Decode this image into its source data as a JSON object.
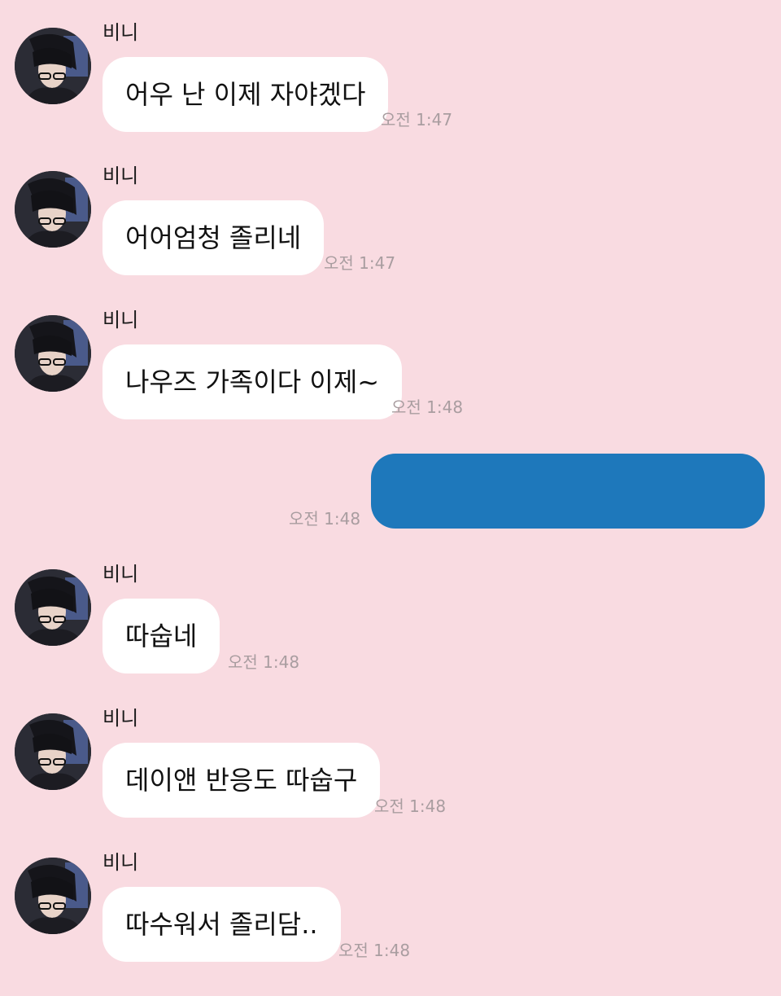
{
  "messages": [
    {
      "sender": "비니",
      "text": "어우 난 이제 자야겠다",
      "time": "오전 1:47"
    },
    {
      "sender": "비니",
      "text": "어어엄청 졸리네",
      "time": "오전 1:47"
    },
    {
      "sender": "비니",
      "text": "나우즈 가족이다 이제~",
      "time": "오전 1:48"
    },
    {
      "sender": "",
      "text": "",
      "time": "오전 1:48",
      "outgoing": true
    },
    {
      "sender": "비니",
      "text": "따숩네",
      "time": "오전 1:48"
    },
    {
      "sender": "비니",
      "text": "데이앤 반응도 따숩구",
      "time": "오전 1:48"
    },
    {
      "sender": "비니",
      "text": "따수워서 졸리담..",
      "time": "오전 1:48"
    }
  ],
  "colors": {
    "background": "#f9dbe1",
    "incoming_bubble": "#ffffff",
    "outgoing_bubble": "#1e78bb",
    "timestamp": "#a99da0"
  },
  "icons": {
    "avatar": "profile-photo-avatar"
  }
}
